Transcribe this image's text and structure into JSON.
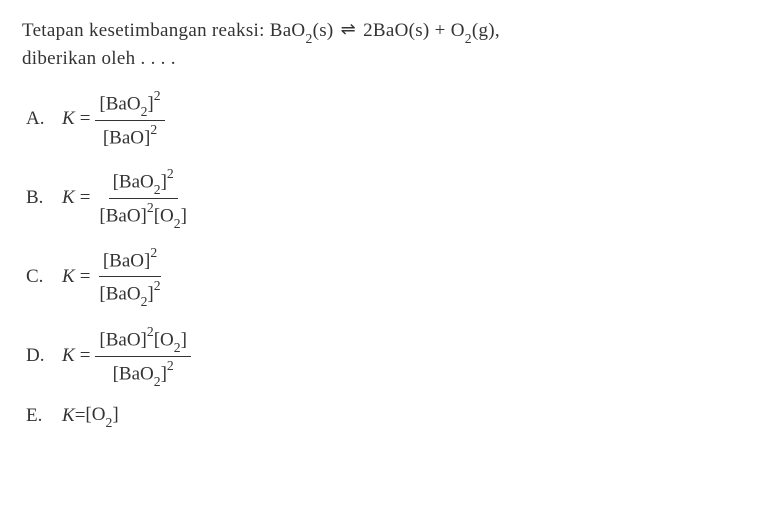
{
  "question": {
    "line1_prefix": "Tetapan kesetimbangan reaksi: ",
    "line2": "diberikan oleh . . . .",
    "reaction": {
      "left": "BaO",
      "left_sub": "2",
      "left_state": "(s)",
      "arrow": "⇌",
      "right1_coef": "2",
      "right1": "BaO",
      "right1_state": "(s)",
      "plus": " + ",
      "right2": "O",
      "right2_sub": "2",
      "right2_state": "(g)",
      "comma": ","
    }
  },
  "options": {
    "A": {
      "label": "A.",
      "kvar": "K",
      "eq": "=",
      "num": "[BaO",
      "num_sub": "2",
      "num_close": "]",
      "num_sup": "2",
      "den": "[BaO]",
      "den_sup": "2"
    },
    "B": {
      "label": "B.",
      "kvar": "K",
      "eq": "=",
      "num": "[BaO",
      "num_sub": "2",
      "num_close": "]",
      "num_sup": "2",
      "den1": "[BaO]",
      "den1_sup": "2",
      "den2": "[O",
      "den2_sub": "2",
      "den2_close": "]"
    },
    "C": {
      "label": "C.",
      "kvar": "K",
      "eq": "=",
      "num": "[BaO]",
      "num_sup": "2",
      "den": "[BaO",
      "den_sub": "2",
      "den_close": "]",
      "den_sup": "2"
    },
    "D": {
      "label": "D.",
      "kvar": "K",
      "eq": "=",
      "num1": "[BaO]",
      "num1_sup": "2",
      "num2": "[O",
      "num2_sub": "2",
      "num2_close": "]",
      "den": "[BaO",
      "den_sub": "2",
      "den_close": "]",
      "den_sup": "2"
    },
    "E": {
      "label": "E.",
      "kvar": "K",
      "eq": "=",
      "rhs": " [O",
      "rhs_sub": "2",
      "rhs_close": "]"
    }
  }
}
